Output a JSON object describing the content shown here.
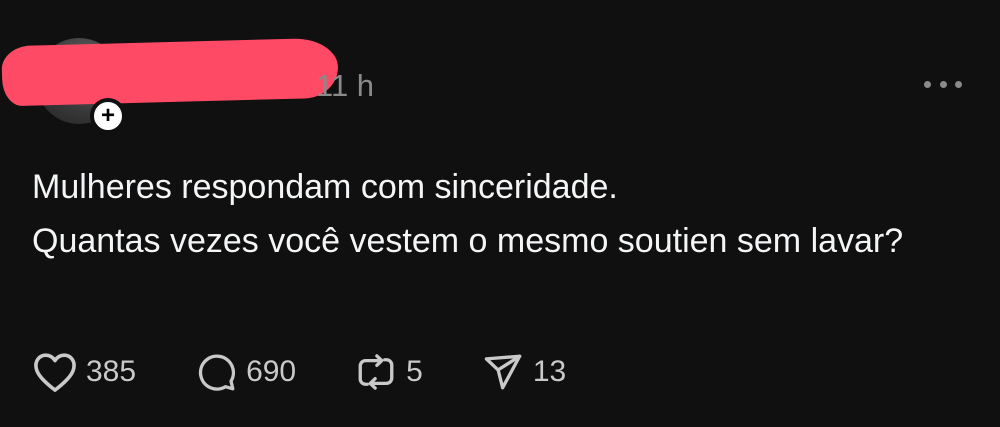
{
  "post": {
    "time": "11 h",
    "text_line_1": "Mulheres respondam com sinceridade.",
    "text_line_2": "Quantas vezes você vestem o mesmo soutien sem lavar?",
    "follow_symbol": "+"
  },
  "actions": {
    "like_count": "385",
    "reply_count": "690",
    "repost_count": "5",
    "share_count": "13"
  },
  "colors": {
    "background": "#101010",
    "text": "#f3f5f7",
    "muted": "#8a8a8a",
    "redaction": "#ff4a66"
  },
  "icons": [
    "heart-icon",
    "comment-icon",
    "repost-icon",
    "share-icon",
    "more-icon",
    "plus-icon"
  ]
}
